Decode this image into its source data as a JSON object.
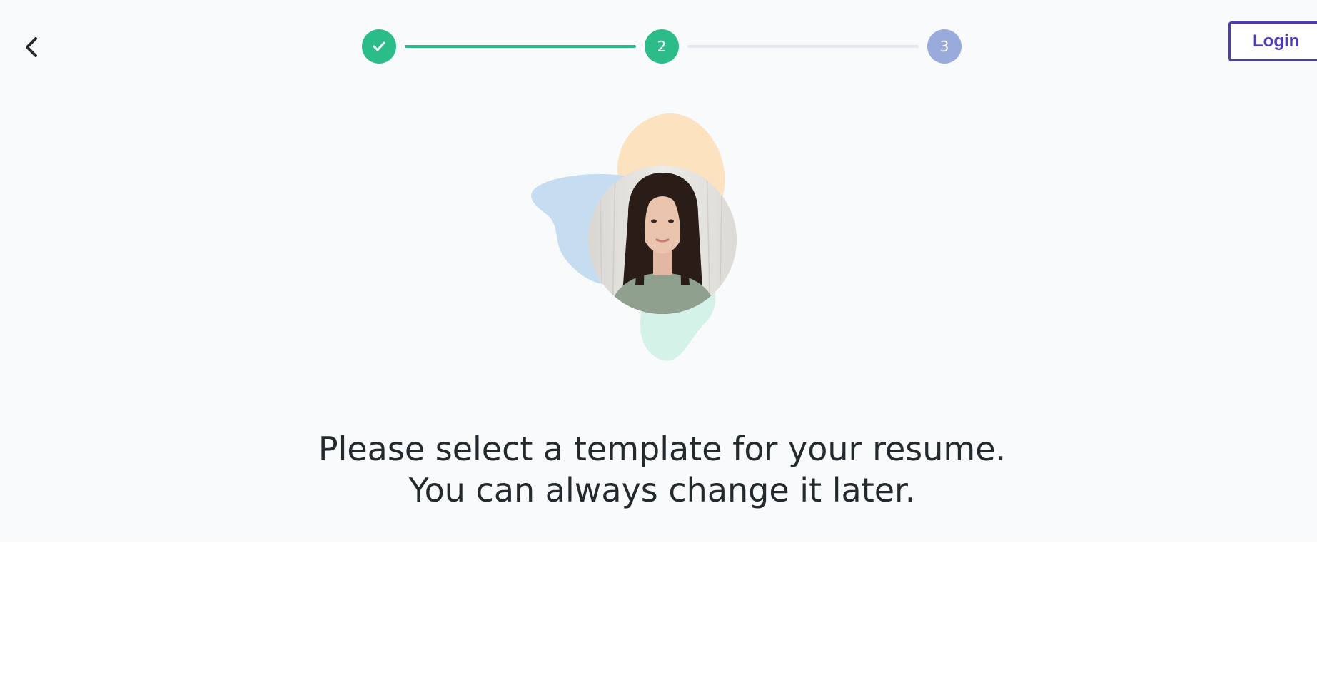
{
  "header": {
    "back_icon": "chevron-left-icon",
    "login_label": "Login"
  },
  "stepper": {
    "steps": [
      {
        "label": "",
        "state": "completed",
        "icon": "check-icon"
      },
      {
        "label": "2",
        "state": "active"
      },
      {
        "label": "3",
        "state": "upcoming"
      }
    ]
  },
  "illustration": {
    "icon": "profile-photo-avatar"
  },
  "main": {
    "headline_line1": "Please select a template for your resume.",
    "headline_line2": "You can always change it later."
  },
  "colors": {
    "accent_green": "#2bbc8a",
    "step_upcoming": "#98abdb",
    "brand_purple": "#4f3bb8",
    "text_dark": "#222a2e",
    "hero_bg": "#f8fafc"
  }
}
